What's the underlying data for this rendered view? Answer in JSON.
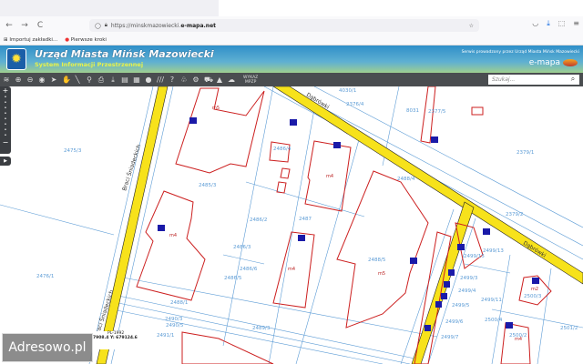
{
  "browser": {
    "url_prefix": "https://minskmazowiecki.",
    "url_domain": "e-mapa.net",
    "bookmarks": [
      "Importuj zakładki...",
      "Pierwsze kroki"
    ]
  },
  "header": {
    "title": "Urząd Miasta Mińsk Mazowiecki",
    "subtitle": "System Informacji Przestrzennej",
    "operator": "Serwis prowadzony przez Urząd Miasta Mińsk Mazowiecki",
    "brand": "e-mapa"
  },
  "toolbar": {
    "wykaz_label": "WYKAZ",
    "mpzp_label": "MPZP",
    "search_placeholder": "Szukaj..."
  },
  "map": {
    "streets": [
      "Braci Śniadeckich",
      "Dąbrówki",
      "Dąbrówki",
      "Braci Śniadeckich"
    ],
    "parcels": [
      "2475/3",
      "2485/3",
      "2486/2",
      "2487",
      "2486/3",
      "2486/6",
      "2486/5",
      "2486/4",
      "2488/1",
      "2489/3",
      "2490/3",
      "2490/5",
      "2491/1",
      "2476/1",
      "8031",
      "2377/5",
      "2376/4",
      "2379/1",
      "2488/4",
      "2488/5",
      "2499/15",
      "2499/13",
      "2499/3",
      "2499/4",
      "2499/5",
      "2499/6",
      "2499/7",
      "2499/11",
      "2500/4",
      "2500/3",
      "2500/2",
      "2501/2",
      "2379/2",
      "4030/1"
    ],
    "building_labels": [
      "m5",
      "m4",
      "m4",
      "m4",
      "m5",
      "m2",
      "m4"
    ],
    "colors": {
      "street": "#f7e21b",
      "parcel": "#5b9bd5",
      "building": "#cc1f1f",
      "address": "#1a1aa8"
    }
  },
  "status": {
    "projection": "PL-1992",
    "x": "7908.4",
    "y": "Y: 679124.6"
  },
  "watermark": "Adresowo.pl"
}
